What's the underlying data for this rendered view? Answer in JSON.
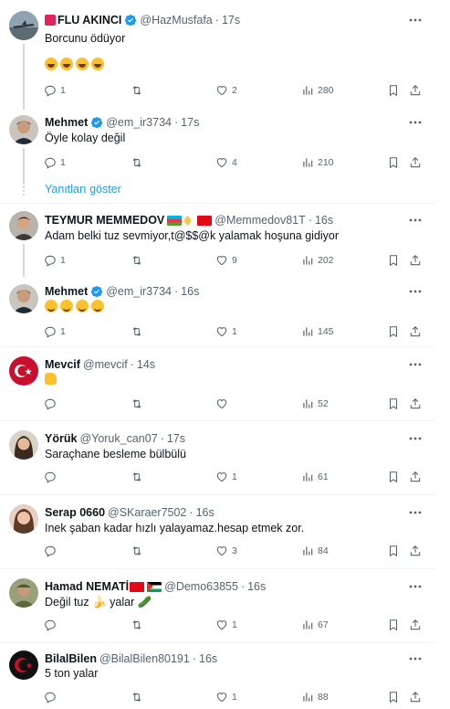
{
  "colors": {
    "accent": "#1d9bf0",
    "muted": "#536471",
    "text": "#0f1419",
    "verified": "#1d9bf0"
  },
  "show_replies_label": "Yanıtları göster",
  "tweets": [
    {
      "name": "FLU AKINCI",
      "handle": "@HazMusfafa",
      "sep": "·",
      "time": "17s",
      "text": "Borcunu ödüyor",
      "emoji_line": "😂😂😂😂",
      "replies": "1",
      "likes": "2",
      "views": "280",
      "verified": true,
      "avatar": "plane-avatar"
    },
    {
      "name": "Mehmet",
      "handle": "@em_ir3734",
      "sep": "·",
      "time": "17s",
      "text": "Öyle kolay değil",
      "replies": "1",
      "likes": "4",
      "views": "210",
      "verified": true,
      "avatar": "man-avatar"
    },
    {
      "name": "TEYMUR MEMMEDOV",
      "flags": "🇦🇿 🌙 🇹🇷",
      "handle": "@Memmedov81T",
      "sep": "·",
      "time": "16s",
      "text": "Adam belki tuz sevmiyor,t@$$@k yalamak hoşuna gidiyor",
      "replies": "1",
      "likes": "9",
      "views": "202",
      "avatar": "man2-avatar"
    },
    {
      "name": "Mehmet",
      "handle": "@em_ir3734",
      "sep": "·",
      "time": "16s",
      "text": "🤭😃😃😃",
      "replies": "1",
      "likes": "1",
      "views": "145",
      "verified": true,
      "avatar": "man-avatar"
    },
    {
      "name": "Mevcif",
      "handle": "@mevcif",
      "sep": "·",
      "time": "14s",
      "text": "👍",
      "replies": "",
      "likes": "",
      "views": "52",
      "avatar": "flag-avatar"
    },
    {
      "name": "Yörük",
      "handle": "@Yoruk_can07",
      "sep": "·",
      "time": "17s",
      "text": "Saraçhane besleme bülbülü",
      "replies": "",
      "likes": "1",
      "views": "61",
      "avatar": "woman-avatar"
    },
    {
      "name": "Serap 0660",
      "handle": "@SKaraer7502",
      "sep": "·",
      "time": "16s",
      "text": "Inek şaban kadar hızlı yalayamaz.hesap etmek zor.",
      "replies": "",
      "likes": "3",
      "views": "84",
      "avatar": "woman2-avatar"
    },
    {
      "name": "Hamad NEMATİ",
      "flags": "🇹🇷🇵🇸",
      "handle": "@Demo63855",
      "sep": "·",
      "time": "16s",
      "text": "Değil tuz 🍌 yalar 🥒",
      "replies": "",
      "likes": "1",
      "views": "67",
      "avatar": "soldier-avatar"
    },
    {
      "name": "BilalBilen",
      "handle": "@BilalBilen80191",
      "sep": "·",
      "time": "16s",
      "text": "5 ton yalar",
      "replies": "",
      "likes": "1",
      "views": "88",
      "avatar": "crescent-avatar"
    }
  ]
}
